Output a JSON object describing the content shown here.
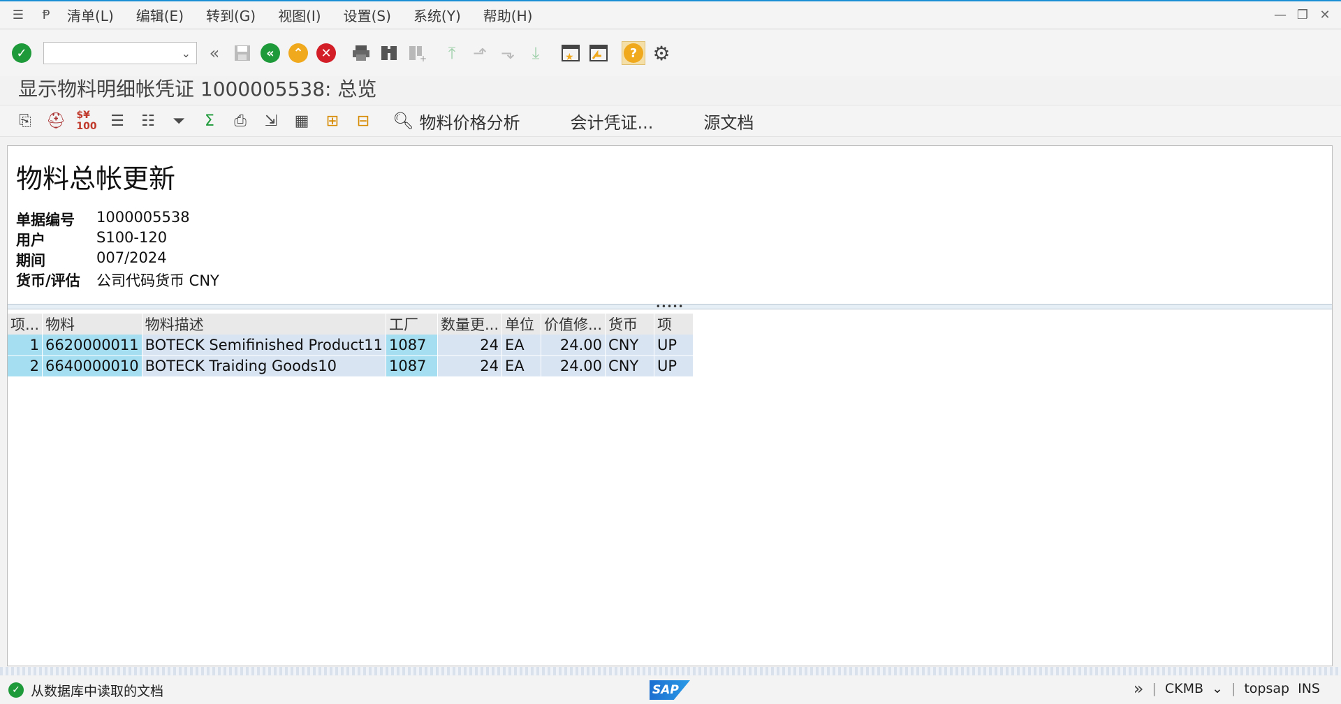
{
  "menu": {
    "items": [
      "清单(L)",
      "编辑(E)",
      "转到(G)",
      "视图(I)",
      "设置(S)",
      "系统(Y)",
      "帮助(H)"
    ]
  },
  "toolbar": {
    "command_field_value": "",
    "icons": [
      "enter-icon",
      "back-double-icon",
      "save-icon",
      "back-icon",
      "exit-icon",
      "cancel-icon",
      "print-icon",
      "find-icon",
      "find-next-icon",
      "first-page-icon",
      "prev-page-icon",
      "next-page-icon",
      "last-page-icon",
      "new-session-icon",
      "shortcut-icon",
      "help-icon",
      "settings-icon"
    ]
  },
  "title": "显示物料明细帐凭证 1000005538: 总览",
  "app_toolbar": {
    "price_analysis": "物料价格分析",
    "accounting_doc": "会计凭证...",
    "source_doc": "源文档"
  },
  "header": {
    "heading": "物料总帐更新",
    "fields": [
      {
        "label": "单据编号",
        "value": "1000005538"
      },
      {
        "label": "用户",
        "value": "S100-120"
      },
      {
        "label": "期间",
        "value": "007/2024"
      },
      {
        "label": "货币/评估",
        "value": "公司代码货币 CNY"
      }
    ]
  },
  "table": {
    "columns": [
      "项...",
      "物料",
      "物料描述",
      "工厂",
      "数量更...",
      "单位",
      "价值修...",
      "货币",
      "项"
    ],
    "rows": [
      [
        "1",
        "6620000011",
        "BOTECK Semifinished Product11",
        "1087",
        "24",
        "EA",
        "24.00",
        "CNY",
        "UP"
      ],
      [
        "2",
        "6640000010",
        "BOTECK Traiding Goods10",
        "1087",
        "24",
        "EA",
        "24.00",
        "CNY",
        "UP"
      ]
    ]
  },
  "status": {
    "message": "从数据库中读取的文档",
    "sap_logo": "SAP",
    "transaction": "CKMB",
    "server": "topsap",
    "mode": "INS"
  },
  "colors": {
    "key_cell": "#a4def0",
    "data_cell": "#d8e4f2",
    "accent": "#1a8fd6"
  }
}
